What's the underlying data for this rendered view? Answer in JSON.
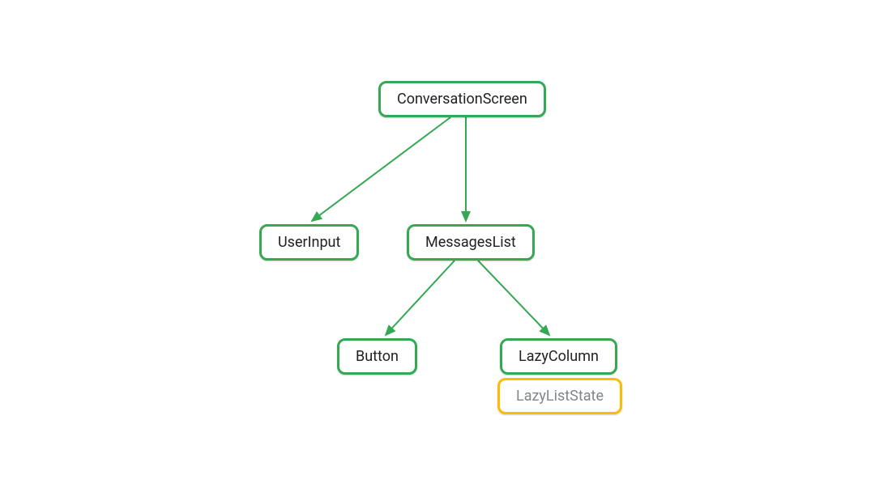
{
  "nodes": {
    "root": "ConversationScreen",
    "userInput": "UserInput",
    "messagesList": "MessagesList",
    "button": "Button",
    "lazyColumn": "LazyColumn",
    "lazyListState": "LazyListState"
  },
  "colors": {
    "green": "#34a853",
    "yellow": "#fbbc04"
  }
}
